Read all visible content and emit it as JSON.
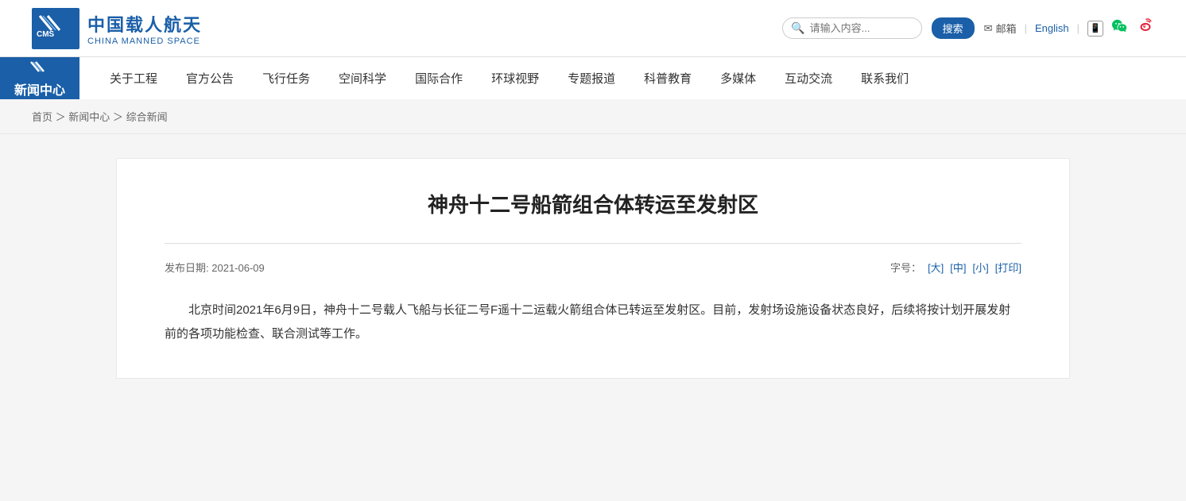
{
  "header": {
    "logo_cn": "中国载人航天",
    "logo_en": "CHINA MANNED SPACE",
    "logo_cms": "CMS",
    "search_placeholder": "请输入内容...",
    "search_button": "搜索",
    "email_label": "邮箱",
    "lang_label": "English"
  },
  "nav": {
    "active_label": "新闻中心",
    "items": [
      {
        "label": "关于工程"
      },
      {
        "label": "官方公告"
      },
      {
        "label": "飞行任务"
      },
      {
        "label": "空间科学"
      },
      {
        "label": "国际合作"
      },
      {
        "label": "环球视野"
      },
      {
        "label": "专题报道"
      },
      {
        "label": "科普教育"
      },
      {
        "label": "多媒体"
      },
      {
        "label": "互动交流"
      },
      {
        "label": "联系我们"
      }
    ]
  },
  "breadcrumb": {
    "home": "首页",
    "sep1": "＞",
    "news_center": "新闻中心",
    "sep2": "＞",
    "current": "综合新闻"
  },
  "article": {
    "title": "神舟十二号船箭组合体转运至发射区",
    "publish_label": "发布日期:",
    "publish_date": "2021-06-09",
    "font_size_label": "字号：",
    "font_large": "[大]",
    "font_medium": "[中]",
    "font_small": "[小]",
    "print_label": "[打印]",
    "body": "北京时间2021年6月9日，神舟十二号载人飞船与长征二号F遥十二运载火箭组合体已转运至发射区。目前，发射场设施设备状态良好，后续将按计划开展发射前的各项功能检查、联合测试等工作。"
  }
}
